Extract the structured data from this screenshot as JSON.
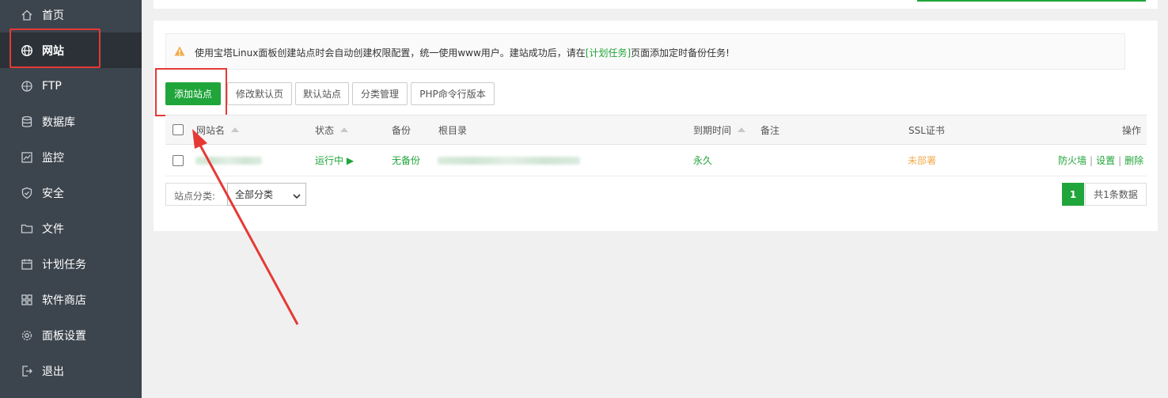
{
  "sidebar": {
    "items": [
      {
        "label": "首页",
        "icon": "home-icon"
      },
      {
        "label": "网站",
        "icon": "globe-icon"
      },
      {
        "label": "FTP",
        "icon": "ftp-icon"
      },
      {
        "label": "数据库",
        "icon": "database-icon"
      },
      {
        "label": "监控",
        "icon": "monitor-icon"
      },
      {
        "label": "安全",
        "icon": "shield-icon"
      },
      {
        "label": "文件",
        "icon": "folder-icon"
      },
      {
        "label": "计划任务",
        "icon": "calendar-icon"
      },
      {
        "label": "软件商店",
        "icon": "grid-icon"
      },
      {
        "label": "面板设置",
        "icon": "gear-icon"
      },
      {
        "label": "退出",
        "icon": "logout-icon"
      }
    ],
    "active": "网站"
  },
  "notice": {
    "text_before": "使用宝塔Linux面板创建站点时会自动创建权限配置，统一使用www用户。建站成功后，请在",
    "link": "[计划任务]",
    "text_after": "页面添加定时备份任务!"
  },
  "toolbar": {
    "add_site": "添加站点",
    "edit_default_page": "修改默认页",
    "default_site": "默认站点",
    "category_manage": "分类管理",
    "php_cli_version": "PHP命令行版本"
  },
  "table": {
    "headers": {
      "site_name": "网站名",
      "status": "状态",
      "backup": "备份",
      "root_dir": "根目录",
      "expire": "到期时间",
      "remark": "备注",
      "ssl": "SSL证书",
      "actions": "操作"
    },
    "rows": [
      {
        "status": "运行中 ▶",
        "backup": "无备份",
        "expire": "永久",
        "ssl": "未部署",
        "action_firewall": "防火墙",
        "action_settings": "设置",
        "action_delete": "删除"
      }
    ]
  },
  "footer": {
    "category_label": "站点分类:",
    "category_value": "全部分类",
    "current_page": "1",
    "total": "共1条数据"
  },
  "colors": {
    "accent": "#20a53a",
    "sidebar_bg": "#3c444d",
    "highlight": "#e53935",
    "warning": "#f0ad4e"
  }
}
